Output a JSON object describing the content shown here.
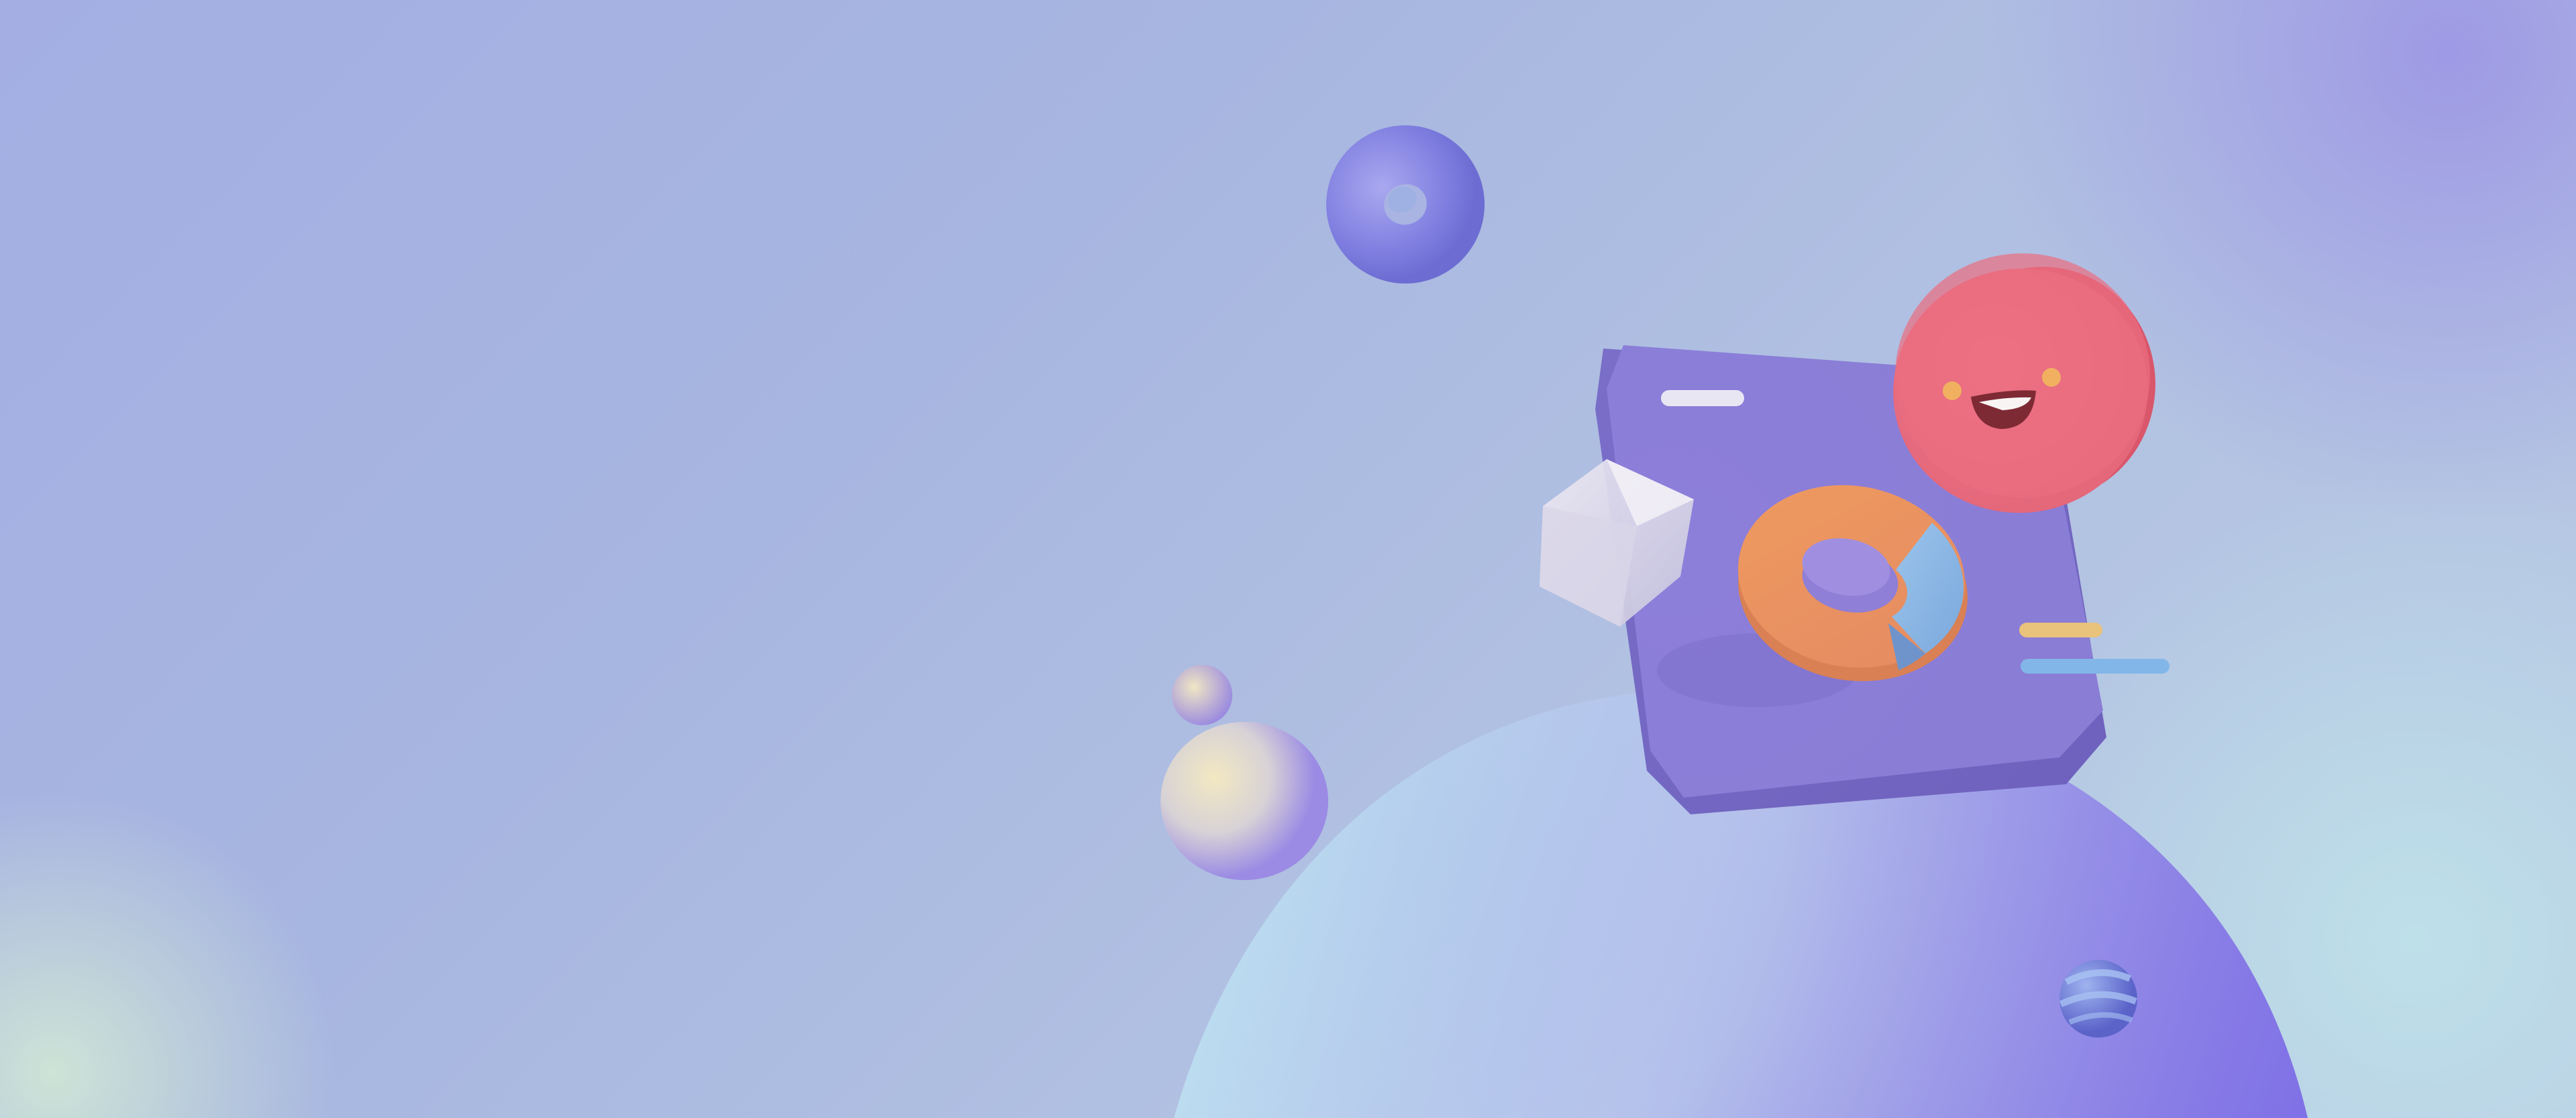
{
  "scene": {
    "description_visible_text": "",
    "colors": {
      "background": "#a8b5e1",
      "sphere_light": "#b8e4f2",
      "sphere_purple": "#8a7ae8",
      "card": "#8b7fd8",
      "face_circle": "#e86a7c",
      "donut_ring": "#7f7fe0",
      "chart_orange": "#e99562",
      "chart_blue": "#8bb6e3",
      "gem": "#e2e1ee",
      "line_yellow": "#e9c27b",
      "line_blue": "#82b6e8"
    },
    "icons": [
      "floating-ring-icon",
      "app-card-icon",
      "smiley-face-icon",
      "donut-chart-icon",
      "gem-polyhedron-icon",
      "orb-icon",
      "striped-ball-icon"
    ]
  }
}
